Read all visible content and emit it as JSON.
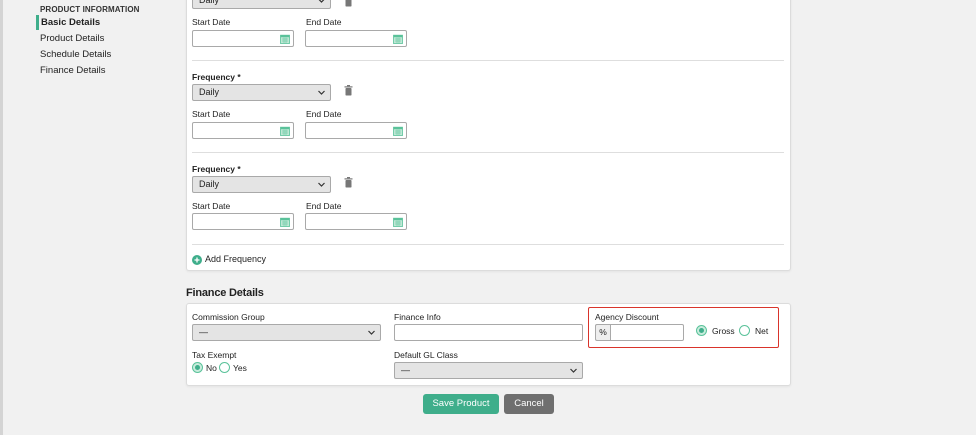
{
  "sidebar": {
    "heading": "PRODUCT INFORMATION",
    "items": [
      {
        "label": "Basic Details",
        "active": true
      },
      {
        "label": "Product Details",
        "active": false
      },
      {
        "label": "Schedule Details",
        "active": false
      },
      {
        "label": "Finance Details",
        "active": false
      }
    ]
  },
  "schedule": {
    "frequency_label": "Frequency *",
    "start_date_label": "Start Date",
    "end_date_label": "End Date",
    "frequency_value": "Daily",
    "add_frequency_label": "Add Frequency"
  },
  "finance": {
    "section_title": "Finance Details",
    "commission_group_label": "Commission Group",
    "commission_group_value": "—",
    "finance_info_label": "Finance Info",
    "agency_discount_label": "Agency Discount",
    "percent_symbol": "%",
    "gross_label": "Gross",
    "net_label": "Net",
    "tax_exempt_label": "Tax Exempt",
    "no_label": "No",
    "yes_label": "Yes",
    "default_gl_class_label": "Default GL Class",
    "default_gl_class_value": "—"
  },
  "actions": {
    "save_label": "Save Product",
    "cancel_label": "Cancel"
  },
  "colors": {
    "accent": "#3fae8b",
    "highlight": "#d9342b",
    "cancel": "#6f6f6f"
  }
}
